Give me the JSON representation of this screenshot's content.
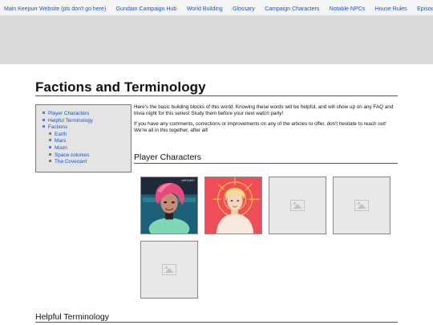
{
  "nav": {
    "links": [
      "Main Keepurr Website (pls don't go here)",
      "Gundam Campaign Hub",
      "World Building",
      "Glossary",
      "Campaign Characters",
      "Notable NPCs",
      "House Rules",
      "Episode Summar"
    ]
  },
  "page": {
    "title": "Factions and Terminology"
  },
  "toc": {
    "items": [
      "Player Characters",
      "Helpful Terminology",
      "Factions"
    ],
    "subitems": [
      "Earth",
      "Mars",
      "Moon",
      "Space colonies",
      "The Covenant"
    ]
  },
  "intro": {
    "p1": "Here's the basic building blocks of this world. Knowing these words will be helpful, and will show up on any FAQ and trivia night for this series! Study them before your next watch party!",
    "p2": "If you have any comments, corrections or improvements on any of the articles to offer, don't hesitate to reach out! We're all in this together, after all!"
  },
  "sections": {
    "player_characters": "Player Characters",
    "helpful_terminology": "Helpful Terminology"
  },
  "cards": {
    "card1_signature": "seKIAAE1"
  },
  "colors": {
    "link": "#1a55c8",
    "banner": "#d9d9d9",
    "toc_bg": "#e4e4e4"
  }
}
